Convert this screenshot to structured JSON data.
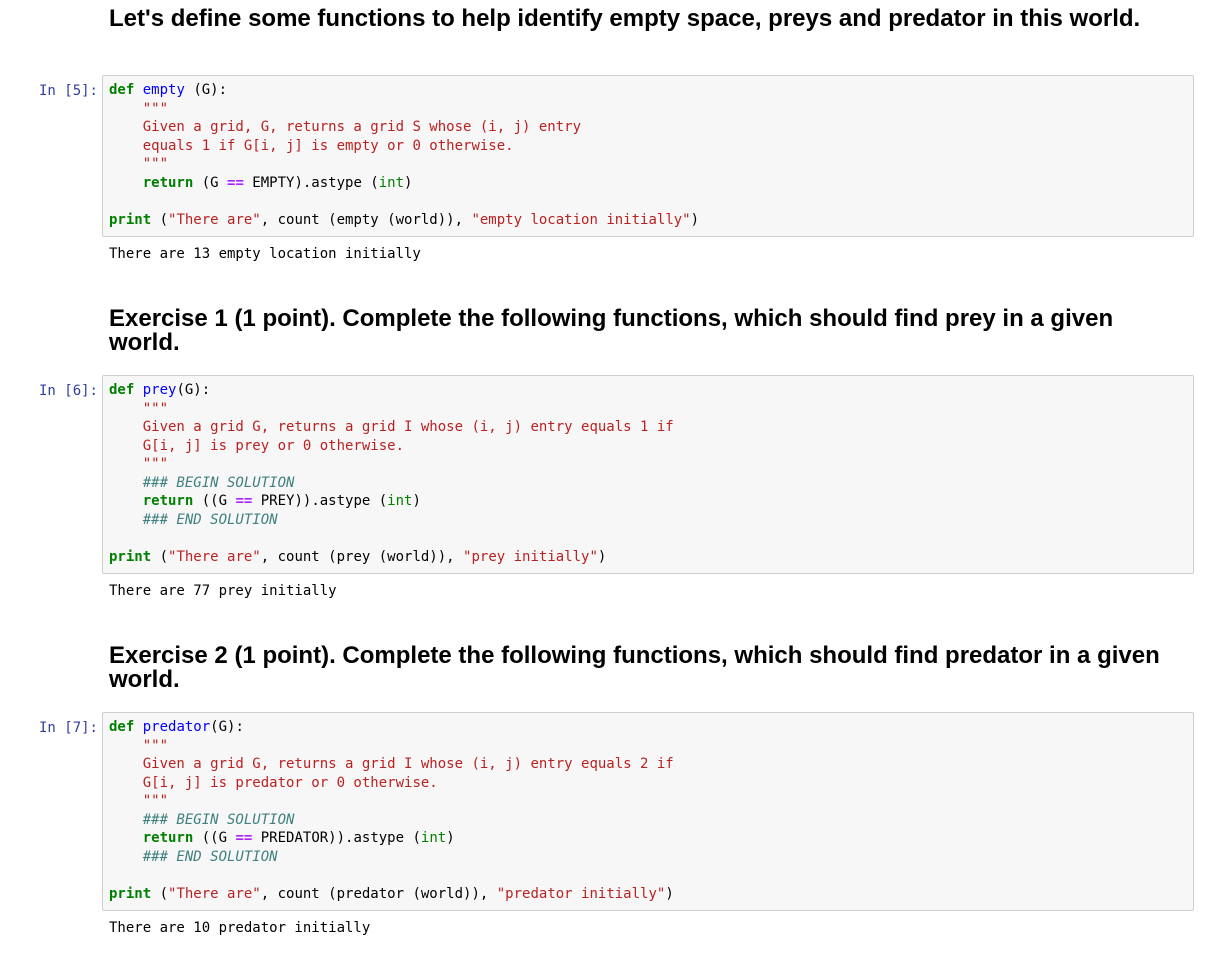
{
  "md1": "Let's define some functions to help identify empty space, preys and predator in this world.",
  "md2": "Exercise 1 (1 point). Complete the following functions, which should find prey in a given world.",
  "md3": "Exercise 2 (1 point). Complete the following functions, which should find predator in a given world.",
  "cell5": {
    "prompt": "In [5]:",
    "def_kw": "def",
    "fn_name": "empty",
    "sig_rest": " (G):",
    "doc_open": "\"\"\"",
    "doc1": "Given a grid, G, returns a grid S whose (i, j) entry",
    "doc2": "equals 1 if G[i, j] is empty or 0 otherwise.",
    "doc_close": "\"\"\"",
    "ret_kw": "return",
    "ret_a": " (G ",
    "ret_op": "==",
    "ret_b": " EMPTY).astype (",
    "ret_bi": "int",
    "ret_c": ")",
    "print_kw": "print",
    "print_a": " (",
    "print_s1": "\"There are\"",
    "print_b": ", count (empty (world)), ",
    "print_s2": "\"empty location initially\"",
    "print_c": ")",
    "output": "There are 13 empty location initially"
  },
  "cell6": {
    "prompt": "In [6]:",
    "def_kw": "def",
    "fn_name": "prey",
    "sig_rest": "(G):",
    "doc_open": "\"\"\"",
    "doc1": "Given a grid G, returns a grid I whose (i, j) entry equals 1 if",
    "doc2": "G[i, j] is prey or 0 otherwise.",
    "doc_close": "\"\"\"",
    "begin": "### BEGIN SOLUTION",
    "ret_kw": "return",
    "ret_a": " ((G ",
    "ret_op": "==",
    "ret_b": " PREY)).astype (",
    "ret_bi": "int",
    "ret_c": ")",
    "end": "### END SOLUTION",
    "print_kw": "print",
    "print_a": " (",
    "print_s1": "\"There are\"",
    "print_b": ", count (prey (world)), ",
    "print_s2": "\"prey initially\"",
    "print_c": ")",
    "output": "There are 77 prey initially"
  },
  "cell7": {
    "prompt": "In [7]:",
    "def_kw": "def",
    "fn_name": "predator",
    "sig_rest": "(G):",
    "doc_open": "\"\"\"",
    "doc1": "Given a grid G, returns a grid I whose (i, j) entry equals 2 if",
    "doc2": "G[i, j] is predator or 0 otherwise.",
    "doc_close": "\"\"\"",
    "begin": "### BEGIN SOLUTION",
    "ret_kw": "return",
    "ret_a": " ((G ",
    "ret_op": "==",
    "ret_b": " PREDATOR)).astype (",
    "ret_bi": "int",
    "ret_c": ")",
    "end": "### END SOLUTION",
    "print_kw": "print",
    "print_a": " (",
    "print_s1": "\"There are\"",
    "print_b": ", count (predator (world)), ",
    "print_s2": "\"predator initially\"",
    "print_c": ")",
    "output": "There are 10 predator initially"
  }
}
